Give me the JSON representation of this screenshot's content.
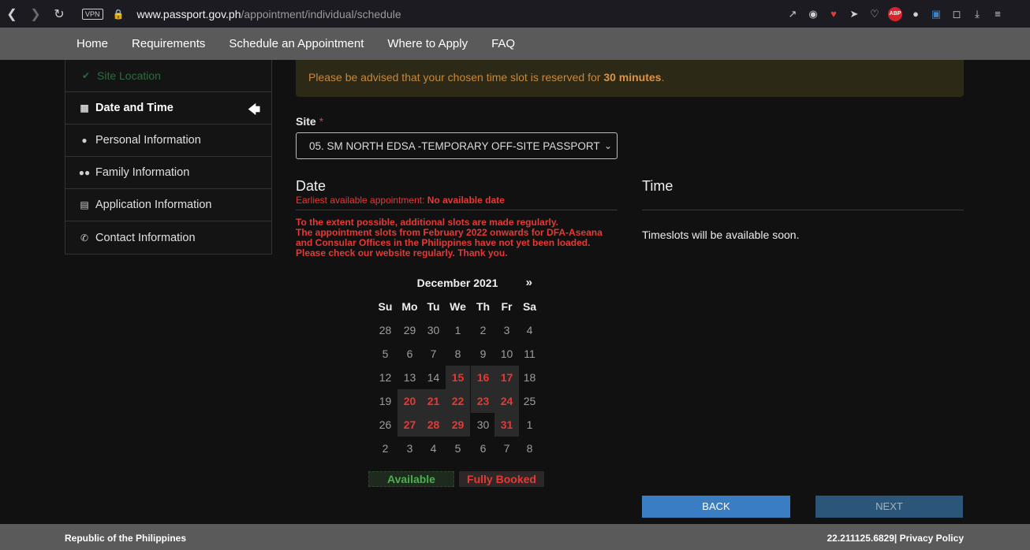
{
  "browser": {
    "vpn_label": "VPN",
    "url_host": "www.passport.gov.ph",
    "url_path": "/appointment/individual/schedule",
    "abp_label": "ABP"
  },
  "nav": {
    "items": [
      "Home",
      "Requirements",
      "Schedule an Appointment",
      "Where to Apply",
      "FAQ"
    ]
  },
  "sidebar": {
    "items": [
      {
        "label": "Site Location",
        "icon": "check-icon"
      },
      {
        "label": "Date and Time",
        "icon": "calendar-icon",
        "active": true
      },
      {
        "label": "Personal Information",
        "icon": "user-icon"
      },
      {
        "label": "Family Information",
        "icon": "users-icon"
      },
      {
        "label": "Application Information",
        "icon": "list-icon"
      },
      {
        "label": "Contact Information",
        "icon": "phone-icon"
      }
    ]
  },
  "alert": {
    "text_before": "Please be advised that your chosen time slot is reserved for ",
    "emphasis": "30 minutes",
    "text_after": "."
  },
  "site": {
    "label": "Site",
    "required_mark": "*",
    "selected": "05. SM NORTH EDSA -TEMPORARY OFF-SITE PASSPORT"
  },
  "date": {
    "heading": "Date",
    "earliest_prefix": "Earliest available appointment: ",
    "earliest_value": "No available date",
    "notice": [
      "To the extent possible, additional slots are made regularly.",
      "The appointment slots from February 2022 onwards for DFA-Aseana",
      "and Consular Offices in the Philippines have not yet been loaded.",
      "Please check our website regularly. Thank you."
    ]
  },
  "time": {
    "heading": "Time",
    "message": "Timeslots will be available soon."
  },
  "calendar": {
    "month": "December 2021",
    "next": "»",
    "weekdays": [
      "Su",
      "Mo",
      "Tu",
      "We",
      "Th",
      "Fr",
      "Sa"
    ],
    "weeks": [
      [
        "28",
        "29",
        "30",
        "1",
        "2",
        "3",
        "4"
      ],
      [
        "5",
        "6",
        "7",
        "8",
        "9",
        "10",
        "11"
      ],
      [
        "12",
        "13",
        "14",
        "15",
        "16",
        "17",
        "18"
      ],
      [
        "19",
        "20",
        "21",
        "22",
        "23",
        "24",
        "25"
      ],
      [
        "26",
        "27",
        "28",
        "29",
        "30",
        "31",
        "1"
      ],
      [
        "2",
        "3",
        "4",
        "5",
        "6",
        "7",
        "8"
      ]
    ],
    "fully_booked": [
      "15",
      "16",
      "17",
      "20",
      "21",
      "22",
      "23",
      "24",
      "27",
      "28",
      "29",
      "31"
    ]
  },
  "legend": {
    "available": "Available",
    "fully_booked": "Fully Booked"
  },
  "buttons": {
    "back": "BACK",
    "next": "NEXT"
  },
  "footer": {
    "left": "Republic of the Philippines",
    "version": "22.211125.6829",
    "separator": "|",
    "privacy": " Privacy Policy"
  }
}
